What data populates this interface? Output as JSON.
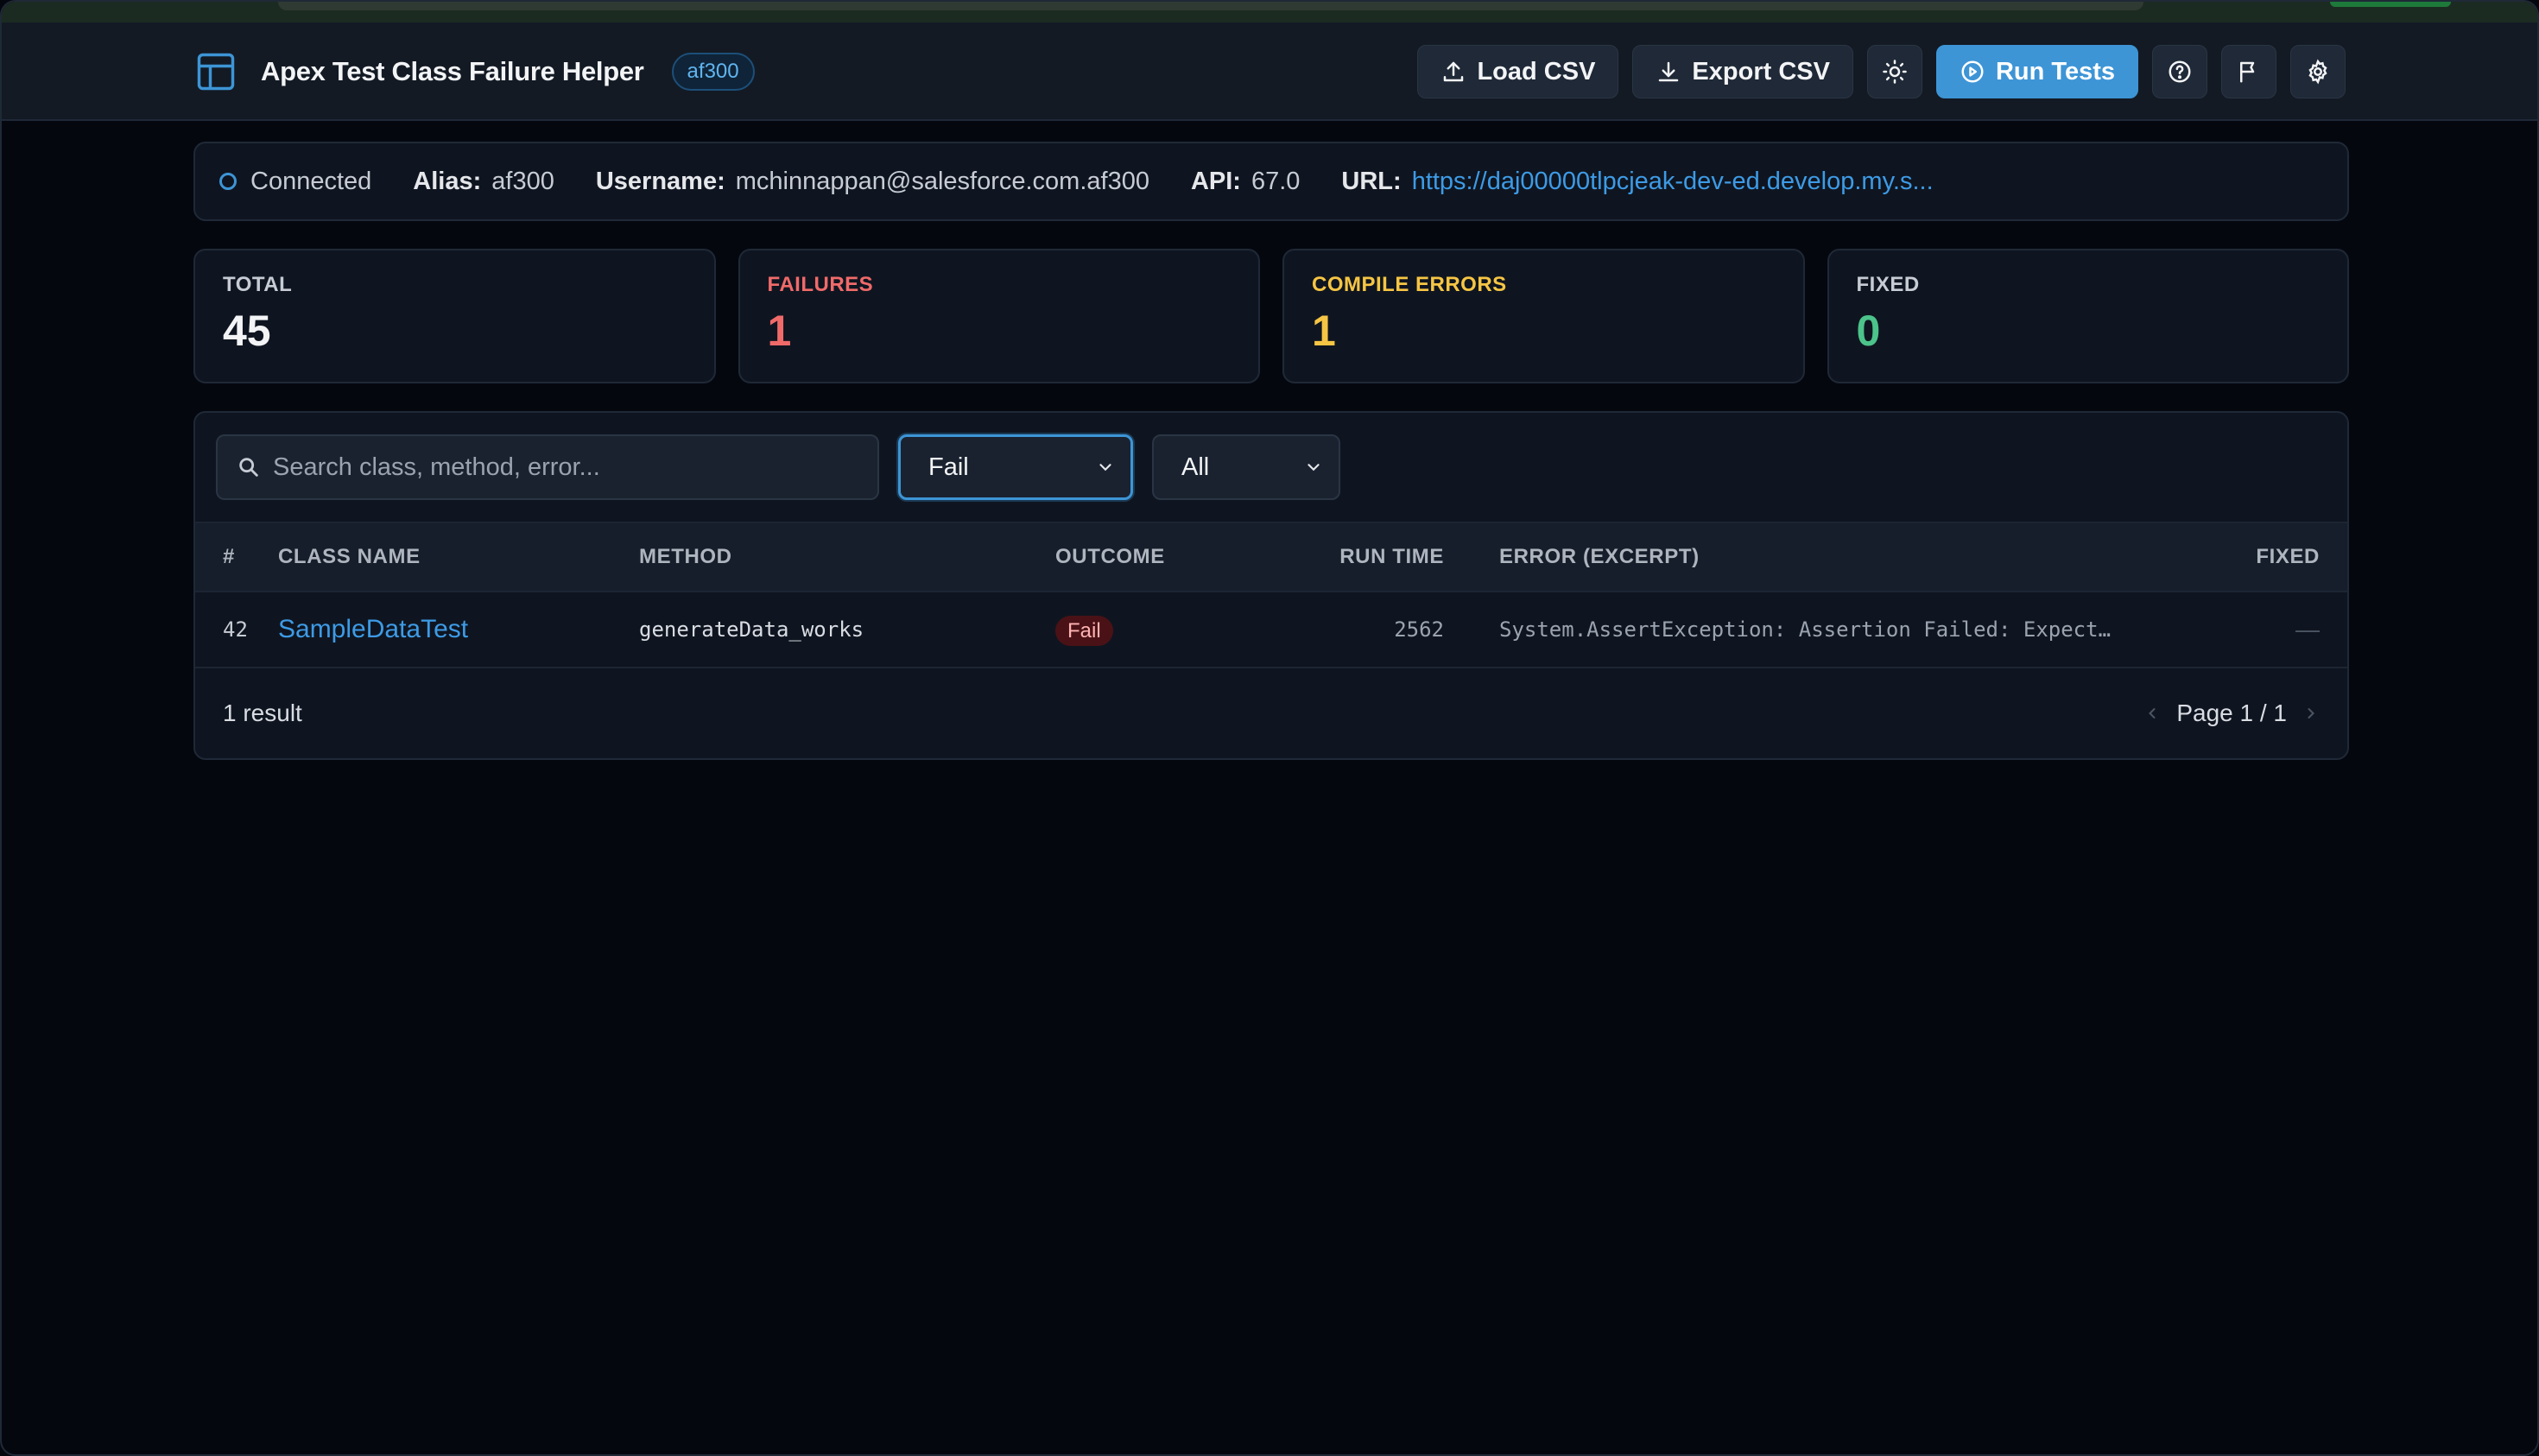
{
  "app": {
    "title": "Apex Test Class Failure Helper",
    "alias_badge": "af300"
  },
  "toolbar": {
    "load_csv": "Load CSV",
    "export_csv": "Export CSV",
    "run_tests": "Run Tests",
    "icons": [
      "upload-icon",
      "download-icon",
      "sun-icon",
      "play-circle-icon",
      "help-icon",
      "flag-icon",
      "gear-icon"
    ]
  },
  "connection": {
    "status": "Connected",
    "alias_label": "Alias:",
    "alias": "af300",
    "username_label": "Username:",
    "username": "mchinnappan@salesforce.com.af300",
    "api_label": "API:",
    "api": "67.0",
    "url_label": "URL:",
    "url": "https://daj00000tlpcjeak-dev-ed.develop.my.s..."
  },
  "stats": [
    {
      "label": "TOTAL",
      "value": "45",
      "color": "#f3f4f6"
    },
    {
      "label": "FAILURES",
      "value": "1",
      "color": "#f06a6a"
    },
    {
      "label": "COMPILE ERRORS",
      "value": "1",
      "color": "#f6c544"
    },
    {
      "label": "FIXED",
      "value": "0",
      "color": "#4cc38a"
    }
  ],
  "filters": {
    "search_placeholder": "Search class, method, error...",
    "outcome_selected": "Fail",
    "scope_selected": "All"
  },
  "table": {
    "columns": [
      "#",
      "CLASS NAME",
      "METHOD",
      "OUTCOME",
      "RUN TIME",
      "ERROR (EXCERPT)",
      "FIXED"
    ],
    "rows": [
      {
        "num": "42",
        "class_name": "SampleDataTest",
        "method": "generateData_works",
        "outcome": "Fail",
        "run_time": "2562",
        "error": "System.AssertException: Assertion Failed: Expect…",
        "fixed": "—"
      }
    ]
  },
  "footer": {
    "result_count": "1 result",
    "page": "Page 1 / 1"
  }
}
